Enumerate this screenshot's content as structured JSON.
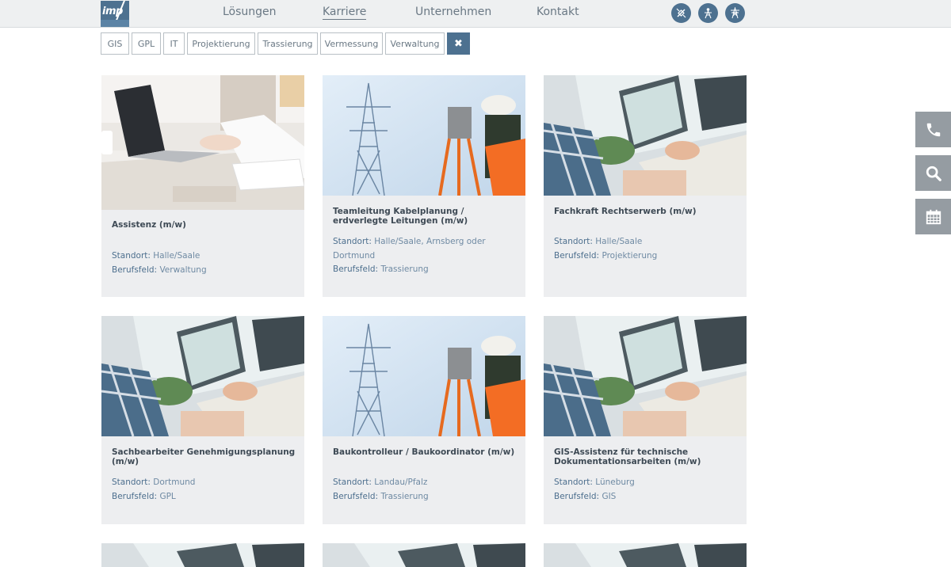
{
  "header": {
    "logo_text": "imp",
    "nav": [
      {
        "label": "Lösungen"
      },
      {
        "label": "Karriere"
      },
      {
        "label": "Unternehmen"
      },
      {
        "label": "Kontakt"
      }
    ],
    "icons": [
      "satellite-icon",
      "person-tower-icon",
      "power-tower-icon"
    ]
  },
  "filters": {
    "items": [
      "GIS",
      "GPL",
      "IT",
      "Projektierung",
      "Trassierung",
      "Vermessung",
      "Verwaltung"
    ],
    "clear_symbol": "✖"
  },
  "jobs": [
    {
      "title": "Assistenz (m/w)",
      "standort": "Halle/Saale",
      "berufsfeld": "Verwaltung",
      "image": "laptop-desk"
    },
    {
      "title": "Teamleitung Kabelplanung / erdverlegte Leitungen (m/w)",
      "standort": "Halle/Saale, Arnsberg oder Dortmund",
      "berufsfeld": "Trassierung",
      "image": "surveyor"
    },
    {
      "title": "Fachkraft Rechtserwerb (m/w)",
      "standort": "Halle/Saale",
      "berufsfeld": "Projektierung",
      "image": "office-monitor"
    },
    {
      "title": "Sachbearbeiter Genehmigungsplanung (m/w)",
      "standort": "Dortmund",
      "berufsfeld": "GPL",
      "image": "office-monitor"
    },
    {
      "title": "Baukontrolleur / Baukoordinator (m/w)",
      "standort": "Landau/Pfalz",
      "berufsfeld": "Trassierung",
      "image": "surveyor"
    },
    {
      "title": "GIS-Assistenz für technische Dokumentationsarbeiten (m/w)",
      "standort": "Lüneburg",
      "berufsfeld": "GIS",
      "image": "office-monitor"
    }
  ],
  "labels": {
    "standort": "Standort:",
    "berufsfeld": "Berufsfeld:"
  },
  "side": [
    "phone-icon",
    "search-icon",
    "calendar-icon"
  ],
  "colors": {
    "accent": "#4d7190",
    "card_bg": "#edeef0",
    "side_btn": "#959ca2"
  }
}
